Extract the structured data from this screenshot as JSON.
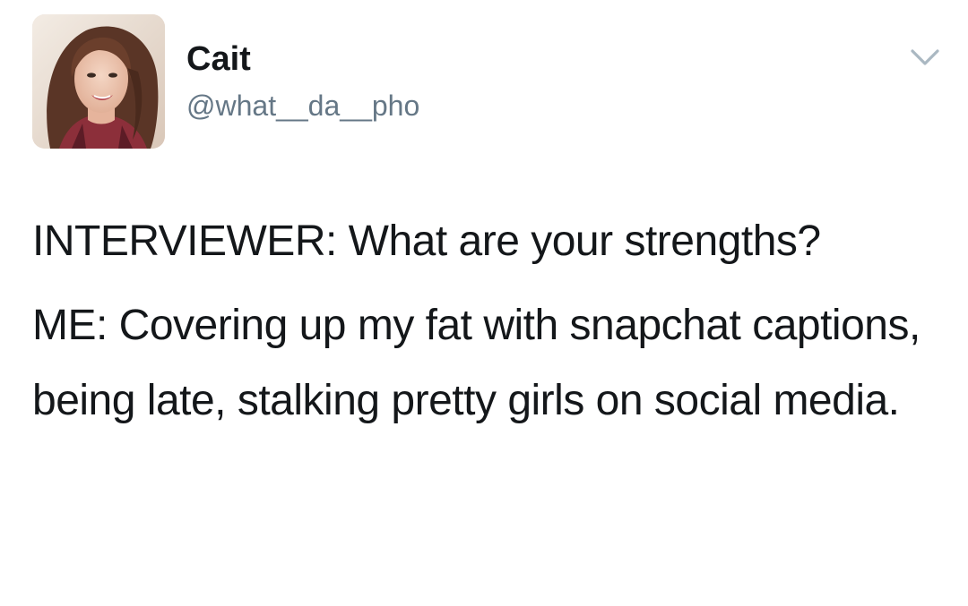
{
  "author": {
    "display_name": "Cait",
    "handle": "@what__da__pho"
  },
  "tweet": {
    "paragraphs": [
      "INTERVIEWER: What are your strengths?",
      "ME: Covering up my fat with snapchat captions, being late, stalking pretty girls on social media."
    ]
  },
  "icons": {
    "avatar": "profile-photo",
    "menu": "chevron-down-icon"
  },
  "colors": {
    "name_text": "#14171a",
    "handle_text": "#657786",
    "chevron": "#aab8c2",
    "background": "#ffffff"
  }
}
